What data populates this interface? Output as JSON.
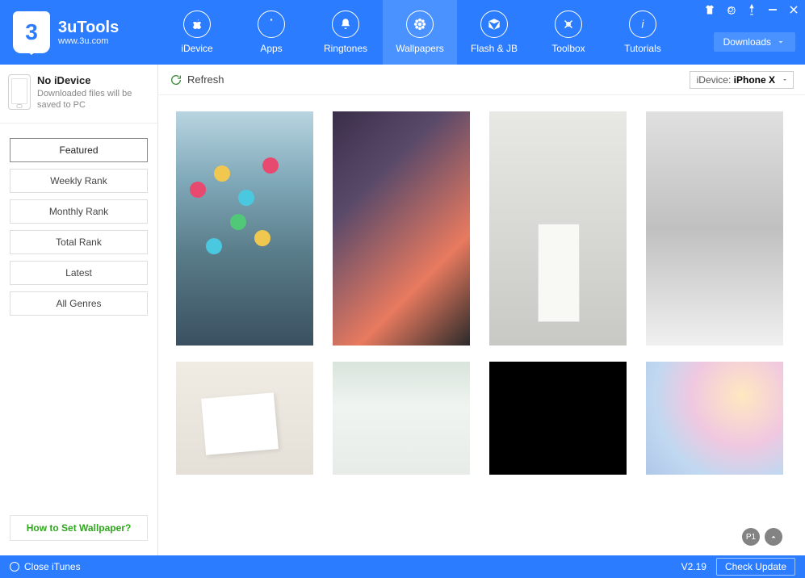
{
  "app": {
    "title": "3uTools",
    "subtitle": "www.3u.com"
  },
  "nav": {
    "tabs": [
      {
        "label": "iDevice",
        "icon": "apple"
      },
      {
        "label": "Apps",
        "icon": "appstore"
      },
      {
        "label": "Ringtones",
        "icon": "bell"
      },
      {
        "label": "Wallpapers",
        "icon": "flower",
        "active": true
      },
      {
        "label": "Flash & JB",
        "icon": "box"
      },
      {
        "label": "Toolbox",
        "icon": "wrench"
      },
      {
        "label": "Tutorials",
        "icon": "info"
      }
    ],
    "downloads_label": "Downloads"
  },
  "sidebar": {
    "device_title": "No iDevice",
    "device_sub": "Downloaded files will be saved to PC",
    "filters": [
      {
        "label": "Featured",
        "active": true
      },
      {
        "label": "Weekly Rank"
      },
      {
        "label": "Monthly Rank"
      },
      {
        "label": "Total Rank"
      },
      {
        "label": "Latest"
      },
      {
        "label": "All Genres"
      }
    ],
    "howto_label": "How to Set Wallpaper?"
  },
  "toolbar": {
    "refresh_label": "Refresh",
    "device_select_prefix": "iDevice:",
    "device_select_value": "iPhone X"
  },
  "grid": {
    "page_label": "P1"
  },
  "footer": {
    "close_itunes_label": "Close iTunes",
    "version_label": "V2.19",
    "check_update_label": "Check Update"
  }
}
